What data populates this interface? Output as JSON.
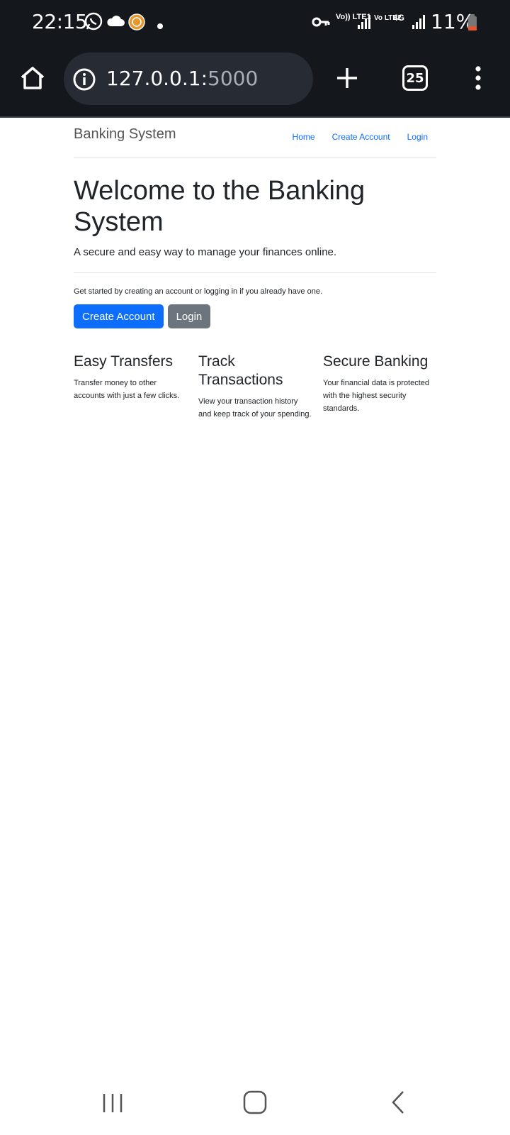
{
  "status_bar": {
    "time": "22:15",
    "network_1": "Vo)) LTE1",
    "network_2": "Vo LTE2",
    "network_type": "4G",
    "battery": "11%",
    "battery_color": "#e8542f"
  },
  "browser": {
    "url_host": "127.0.0.1:",
    "url_port": "5000",
    "tab_count": "25"
  },
  "navbar": {
    "brand": "Banking System",
    "links": [
      "Home",
      "Create Account",
      "Login"
    ]
  },
  "hero": {
    "title": "Welcome to the Banking System",
    "lead": "A secure and easy way to manage your finances online.",
    "prompt": "Get started by creating an account or logging in if you already have one.",
    "create_account_button": "Create Account",
    "login_button": "Login"
  },
  "features": [
    {
      "title": "Easy Transfers",
      "text": "Transfer money to other accounts with just a few clicks."
    },
    {
      "title": "Track Transactions",
      "text": "View your transaction history and keep track of your spending."
    },
    {
      "title": "Secure Banking",
      "text": "Your financial data is protected with the highest security standards."
    }
  ],
  "colors": {
    "primary": "#0d6efd",
    "secondary": "#6c757d",
    "chrome_dark": "#14171c"
  }
}
